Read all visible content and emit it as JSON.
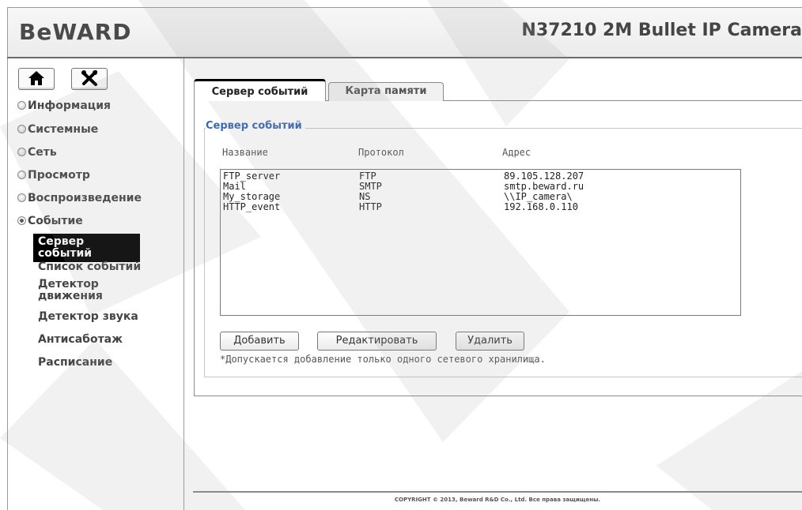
{
  "header": {
    "logo": "BeWARD",
    "model_title": "N37210 2M Bullet IP Camera"
  },
  "nav_buttons": [
    {
      "name": "home-icon"
    },
    {
      "name": "tools-icon"
    }
  ],
  "sidebar": {
    "menu": [
      {
        "label": "Информация",
        "expanded": false
      },
      {
        "label": "Системные",
        "expanded": false
      },
      {
        "label": "Сеть",
        "expanded": false
      },
      {
        "label": "Просмотр",
        "expanded": false
      },
      {
        "label": "Воспроизведение",
        "expanded": false
      },
      {
        "label": "Событие",
        "expanded": true
      }
    ],
    "submenu": [
      {
        "label": "Сервер событий",
        "active": true
      },
      {
        "label": "Список событий",
        "active": false
      },
      {
        "label": "Детектор движения",
        "active": false
      },
      {
        "label": "Детектор звука",
        "active": false
      },
      {
        "label": "Антисаботаж",
        "active": false
      },
      {
        "label": "Расписание",
        "active": false
      }
    ]
  },
  "tabs": [
    {
      "label": "Сервер событий",
      "active": true
    },
    {
      "label": "Карта памяти",
      "active": false
    }
  ],
  "panel": {
    "legend": "Сервер событий",
    "columns": [
      "Название",
      "Протокол",
      "Адрес"
    ],
    "rows": [
      {
        "name": "FTP_server",
        "protocol": "FTP",
        "address": "89.105.128.207"
      },
      {
        "name": "Mail",
        "protocol": "SMTP",
        "address": "smtp.beward.ru"
      },
      {
        "name": "My_storage",
        "protocol": "NS",
        "address": "\\\\IP_camera\\"
      },
      {
        "name": "HTTP_event",
        "protocol": "HTTP",
        "address": "192.168.0.110"
      }
    ],
    "buttons": {
      "add": "Добавить",
      "edit": "Редактировать",
      "delete": "Удалить"
    },
    "note": "*Допускается добавление только одного сетевого хранилища."
  },
  "footer": {
    "copyright": "COPYRIGHT © 2013, Beward R&D Co., Ltd. Все права защищены."
  },
  "colors": {
    "legend": "#3a67b0",
    "active_submenu_bg": "#000000",
    "watermark": "#dcdcdc"
  }
}
